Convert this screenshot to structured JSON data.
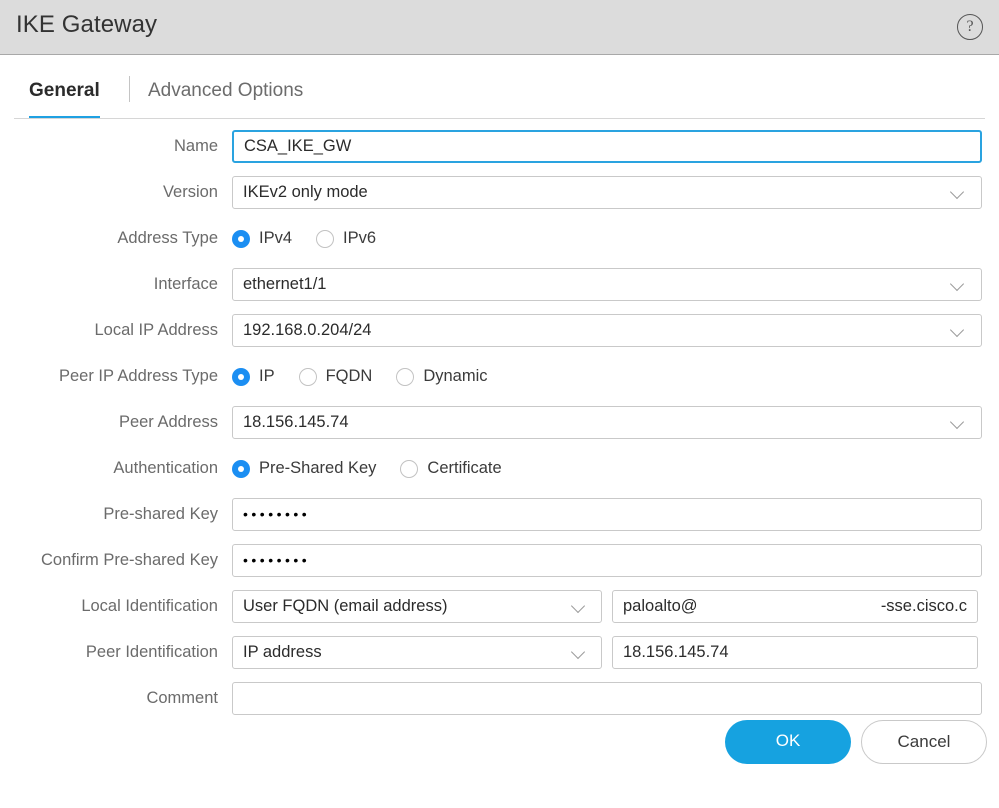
{
  "window": {
    "title": "IKE Gateway",
    "help_icon": "help-circle-icon",
    "help_glyph": "?"
  },
  "tabs": [
    {
      "label": "General",
      "active": true
    },
    {
      "label": "Advanced Options",
      "active": false
    }
  ],
  "form": {
    "name": {
      "label": "Name",
      "value": "CSA_IKE_GW",
      "placeholder": ""
    },
    "version": {
      "label": "Version",
      "value": "IKEv2 only mode"
    },
    "address_type": {
      "label": "Address Type",
      "options": [
        "IPv4",
        "IPv6"
      ],
      "selected": "IPv4"
    },
    "interface": {
      "label": "Interface",
      "value": "ethernet1/1"
    },
    "local_ip_address": {
      "label": "Local IP Address",
      "value": "192.168.0.204/24"
    },
    "peer_ip_address_type": {
      "label": "Peer IP Address Type",
      "options": [
        "IP",
        "FQDN",
        "Dynamic"
      ],
      "selected": "IP"
    },
    "peer_address": {
      "label": "Peer Address",
      "value": "18.156.145.74"
    },
    "authentication": {
      "label": "Authentication",
      "options": [
        "Pre-Shared Key",
        "Certificate"
      ],
      "selected": "Pre-Shared Key"
    },
    "pre_shared_key": {
      "label": "Pre-shared Key",
      "value": "••••••••"
    },
    "confirm_pre_shared_key": {
      "label": "Confirm Pre-shared Key",
      "value": "••••••••"
    },
    "local_identification": {
      "label": "Local Identification",
      "type_value": "User FQDN (email address)",
      "value_left": "paloalto@",
      "value_right": "-sse.cisco.c"
    },
    "peer_identification": {
      "label": "Peer Identification",
      "type_value": "IP address",
      "value": "18.156.145.74"
    },
    "comment": {
      "label": "Comment",
      "value": "",
      "placeholder": ""
    }
  },
  "footer": {
    "ok_label": "OK",
    "cancel_label": "Cancel"
  },
  "colors": {
    "accent": "#16a2e0",
    "radio_selected": "#1b8ef2",
    "tab_underline": "#1fa1e2",
    "titlebar_bg": "#dcdcdc"
  }
}
